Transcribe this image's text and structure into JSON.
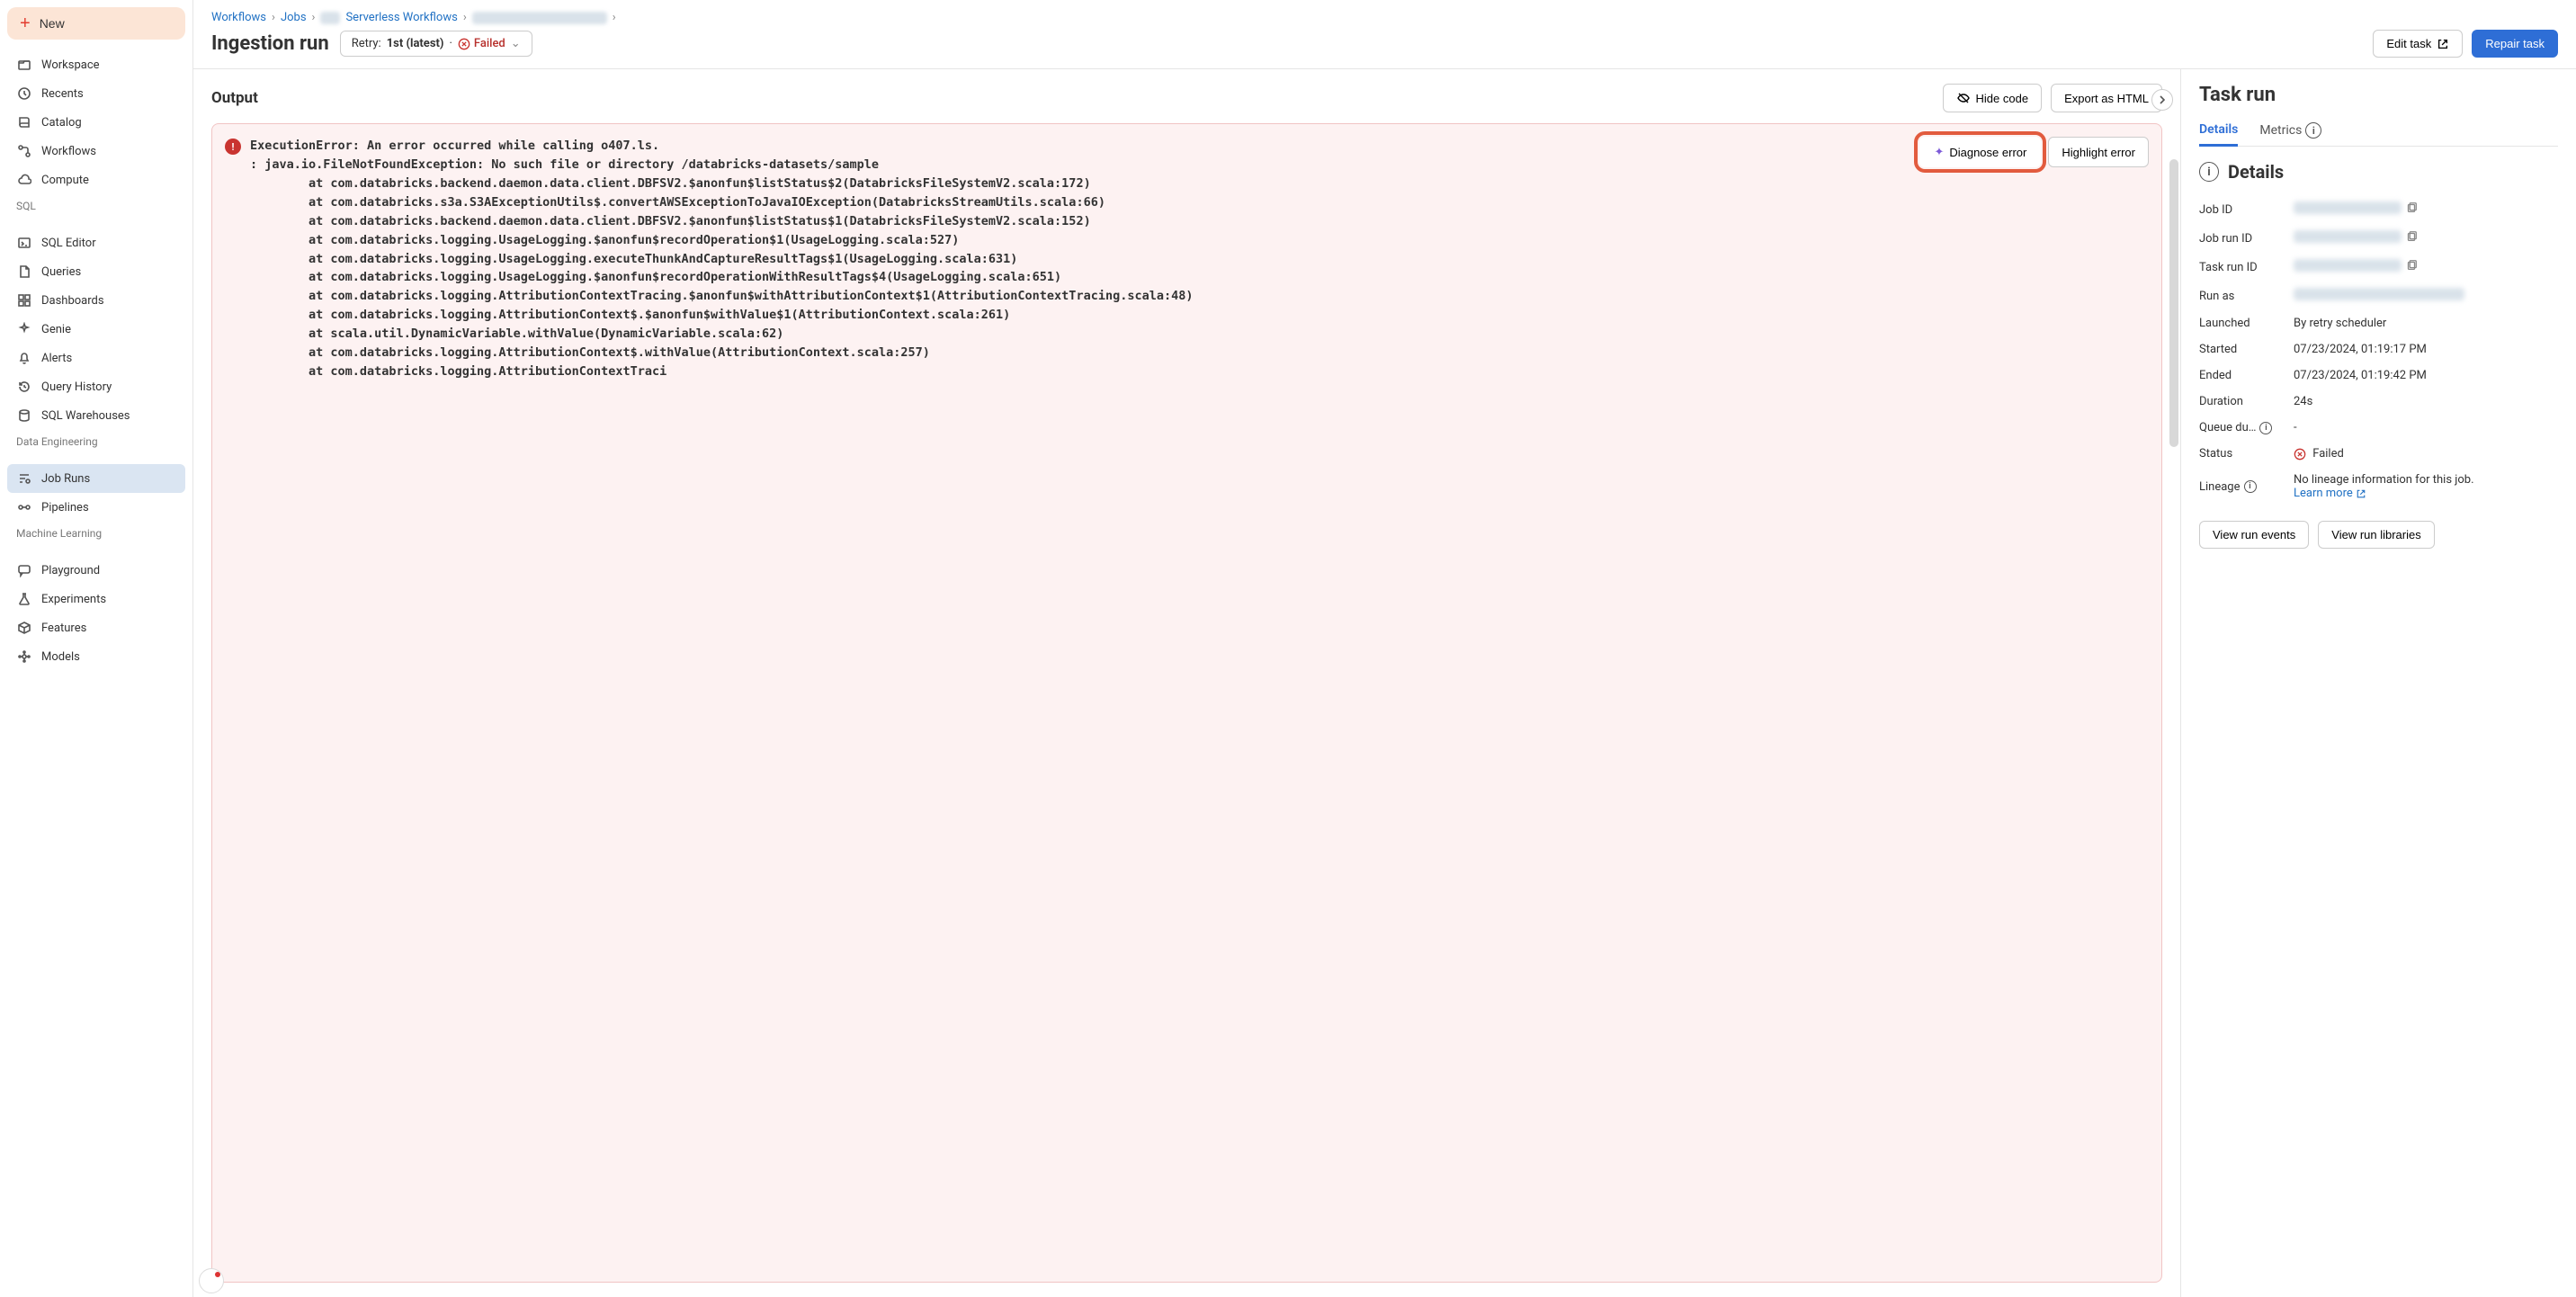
{
  "sidebar": {
    "new_label": "New",
    "top_items": [
      {
        "label": "Workspace",
        "icon": "folder"
      },
      {
        "label": "Recents",
        "icon": "clock"
      },
      {
        "label": "Catalog",
        "icon": "book"
      },
      {
        "label": "Workflows",
        "icon": "flow"
      },
      {
        "label": "Compute",
        "icon": "cloud"
      }
    ],
    "sql_heading": "SQL",
    "sql_items": [
      {
        "label": "SQL Editor",
        "icon": "terminal"
      },
      {
        "label": "Queries",
        "icon": "doc"
      },
      {
        "label": "Dashboards",
        "icon": "grid"
      },
      {
        "label": "Genie",
        "icon": "sparkle"
      },
      {
        "label": "Alerts",
        "icon": "bell"
      },
      {
        "label": "Query History",
        "icon": "history"
      },
      {
        "label": "SQL Warehouses",
        "icon": "db"
      }
    ],
    "de_heading": "Data Engineering",
    "de_items": [
      {
        "label": "Job Runs",
        "icon": "runs",
        "active": true
      },
      {
        "label": "Pipelines",
        "icon": "pipe"
      }
    ],
    "ml_heading": "Machine Learning",
    "ml_items": [
      {
        "label": "Playground",
        "icon": "chat"
      },
      {
        "label": "Experiments",
        "icon": "flask"
      },
      {
        "label": "Features",
        "icon": "box"
      },
      {
        "label": "Models",
        "icon": "model"
      }
    ]
  },
  "breadcrumb": {
    "items": [
      "Workflows",
      "Jobs",
      "Serverless Workflows"
    ]
  },
  "header": {
    "title": "Ingestion run",
    "retry_prefix": "Retry:",
    "retry_value": "1st (latest)",
    "retry_sep": "·",
    "retry_status": "Failed",
    "edit_task": "Edit task",
    "repair_task": "Repair task"
  },
  "output": {
    "title": "Output",
    "hide_code": "Hide code",
    "export_html": "Export as HTML",
    "diagnose": "Diagnose error",
    "highlight": "Highlight error",
    "stack_trace": "ExecutionError: An error occurred while calling o407.ls.\n: java.io.FileNotFoundException: No such file or directory /databricks-datasets/sample\n        at com.databricks.backend.daemon.data.client.DBFSV2.$anonfun$listStatus$2(DatabricksFileSystemV2.scala:172)\n        at com.databricks.s3a.S3AExceptionUtils$.convertAWSExceptionToJavaIOException(DatabricksStreamUtils.scala:66)\n        at com.databricks.backend.daemon.data.client.DBFSV2.$anonfun$listStatus$1(DatabricksFileSystemV2.scala:152)\n        at com.databricks.logging.UsageLogging.$anonfun$recordOperation$1(UsageLogging.scala:527)\n        at com.databricks.logging.UsageLogging.executeThunkAndCaptureResultTags$1(UsageLogging.scala:631)\n        at com.databricks.logging.UsageLogging.$anonfun$recordOperationWithResultTags$4(UsageLogging.scala:651)\n        at com.databricks.logging.AttributionContextTracing.$anonfun$withAttributionContext$1(AttributionContextTracing.scala:48)\n        at com.databricks.logging.AttributionContext$.$anonfun$withValue$1(AttributionContext.scala:261)\n        at scala.util.DynamicVariable.withValue(DynamicVariable.scala:62)\n        at com.databricks.logging.AttributionContext$.withValue(AttributionContext.scala:257)\n        at com.databricks.logging.AttributionContextTraci"
  },
  "right": {
    "title": "Task run",
    "tabs": {
      "details": "Details",
      "metrics": "Metrics"
    },
    "section_title": "Details",
    "rows": {
      "job_id": {
        "label": "Job ID"
      },
      "job_run_id": {
        "label": "Job run ID"
      },
      "task_run_id": {
        "label": "Task run ID"
      },
      "run_as": {
        "label": "Run as"
      },
      "launched": {
        "label": "Launched",
        "value": "By retry scheduler"
      },
      "started": {
        "label": "Started",
        "value": "07/23/2024, 01:19:17 PM"
      },
      "ended": {
        "label": "Ended",
        "value": "07/23/2024, 01:19:42 PM"
      },
      "duration": {
        "label": "Duration",
        "value": "24s"
      },
      "queue": {
        "label": "Queue du…",
        "value": "-"
      },
      "status": {
        "label": "Status",
        "value": "Failed"
      },
      "lineage": {
        "label": "Lineage",
        "value": "No lineage information for this job.",
        "learn": "Learn more"
      }
    },
    "view_events": "View run events",
    "view_libs": "View run libraries"
  }
}
